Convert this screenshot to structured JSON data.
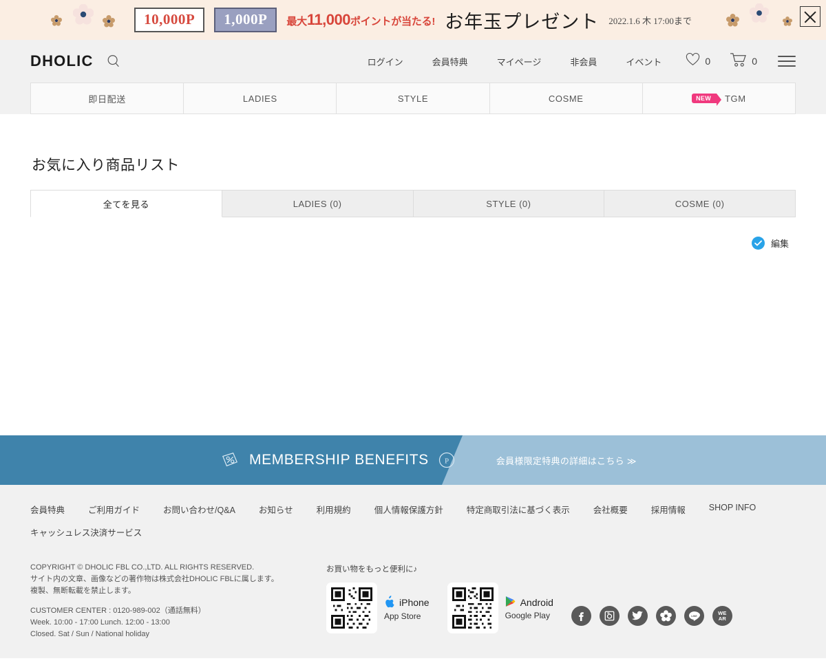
{
  "promo": {
    "point_box_1": "10,000P",
    "point_box_2": "1,000P",
    "max_prefix": "最大",
    "max_number": "11,000",
    "max_suffix": "ポイントが当たる!",
    "title": "お年玉プレゼント",
    "deadline": "2022.1.6 木 17:00まで",
    "close_label": "閉じる",
    "bg_color": "#fbeee3",
    "accent_color": "#d8453a"
  },
  "header": {
    "logo": "DHOLIC",
    "search_icon": "search-icon",
    "nav": [
      {
        "label": "ログイン"
      },
      {
        "label": "会員特典"
      },
      {
        "label": "マイページ"
      },
      {
        "label": "非会員"
      },
      {
        "label": "イベント"
      }
    ],
    "wishlist_count": "0",
    "cart_count": "0",
    "menu_icon": "hamburger-icon"
  },
  "mainnav": {
    "items": [
      {
        "label": "即日配送",
        "badge": ""
      },
      {
        "label": "LADIES",
        "badge": ""
      },
      {
        "label": "STYLE",
        "badge": ""
      },
      {
        "label": "COSME",
        "badge": ""
      },
      {
        "label": "TGM",
        "badge": "NEW"
      }
    ]
  },
  "main": {
    "page_title": "お気に入り商品リスト",
    "tabs": [
      {
        "label": "全てを見る",
        "active": true
      },
      {
        "label": "LADIES (0)",
        "active": false
      },
      {
        "label": "STYLE (0)",
        "active": false
      },
      {
        "label": "COSME (0)",
        "active": false
      }
    ],
    "edit_label": "編集",
    "edit_icon": "check-circle-icon",
    "edit_icon_color": "#29a3e8"
  },
  "membership": {
    "title": "MEMBERSHIP BENEFITS",
    "link": "会員様限定特典の詳細はこちら ≫",
    "left_color": "#3f83ab",
    "right_color": "#9cc0d8"
  },
  "footer": {
    "links": [
      {
        "label": "会員特典"
      },
      {
        "label": "ご利用ガイド"
      },
      {
        "label": "お問い合わせ/Q&A"
      },
      {
        "label": "お知らせ"
      },
      {
        "label": "利用規約"
      },
      {
        "label": "個人情報保護方針"
      },
      {
        "label": "特定商取引法に基づく表示"
      },
      {
        "label": "会社概要"
      },
      {
        "label": "採用情報"
      },
      {
        "label": "SHOP INFO"
      },
      {
        "label": "キャッシュレス決済サービス"
      }
    ],
    "copyright_line1": "COPYRIGHT © DHOLIC FBL CO.,LTD. ALL RIGHTS RESERVED.",
    "copyright_line2": "サイト内の文章、画像などの著作物は株式会社DHOLIC FBLに属します。",
    "copyright_line3": "複製、無断転載を禁止します。",
    "customer_center": "CUSTOMER CENTER : 0120-989-002（通話無料）",
    "hours": "Week. 10:00 - 17:00 Lunch. 12:00 - 13:00",
    "closed": "Closed. Sat / Sun / National holiday",
    "app_heading": "お買い物をもっと便利に♪",
    "apps": [
      {
        "name": "iPhone",
        "store": "App Store",
        "icon": "apple-icon"
      },
      {
        "name": "Android",
        "store": "Google Play",
        "icon": "google-play-icon"
      }
    ],
    "socials": [
      {
        "name": "facebook-icon"
      },
      {
        "name": "instagram-icon"
      },
      {
        "name": "twitter-icon"
      },
      {
        "name": "flower-icon"
      },
      {
        "name": "line-icon"
      },
      {
        "name": "wear-icon",
        "text1": "WE",
        "text2": "AR"
      }
    ]
  }
}
